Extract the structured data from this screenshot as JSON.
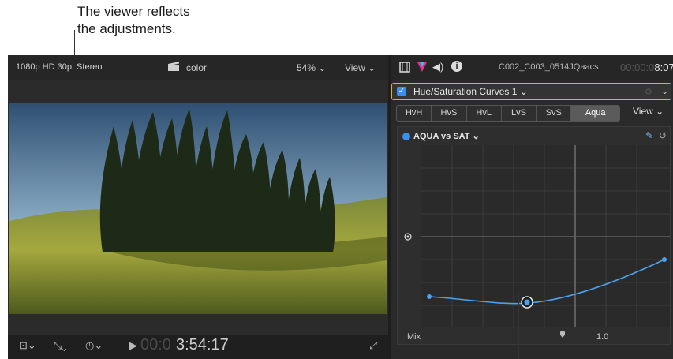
{
  "callout_top": {
    "line1": "The viewer reflects",
    "line2": "the adjustments."
  },
  "viewer": {
    "format": "1080p HD 30p, Stereo",
    "clip_label": "color",
    "zoom": "54% ⌄",
    "view_menu": "View ⌄",
    "timecode_dim": "00:0",
    "timecode": "3:54:17"
  },
  "inspector": {
    "clip_name": "C002_C003_0514JQaacs",
    "timecode_dim": "00:00:0",
    "timecode": "8:07",
    "effect_name": "Hue/Saturation Curves 1 ⌄",
    "tabs": [
      "HvH",
      "HvS",
      "HvL",
      "LvS",
      "SvS",
      "Aqua"
    ],
    "active_tab": "Aqua",
    "view_menu": "View ⌄",
    "curve_title": "AQUA vs SAT ⌄",
    "mix_label": "Mix",
    "mix_value": "1.0"
  },
  "colors": {
    "accent": "#3a8ef0",
    "effect_border": "#d8b433",
    "curve": "#4aa3f0"
  }
}
